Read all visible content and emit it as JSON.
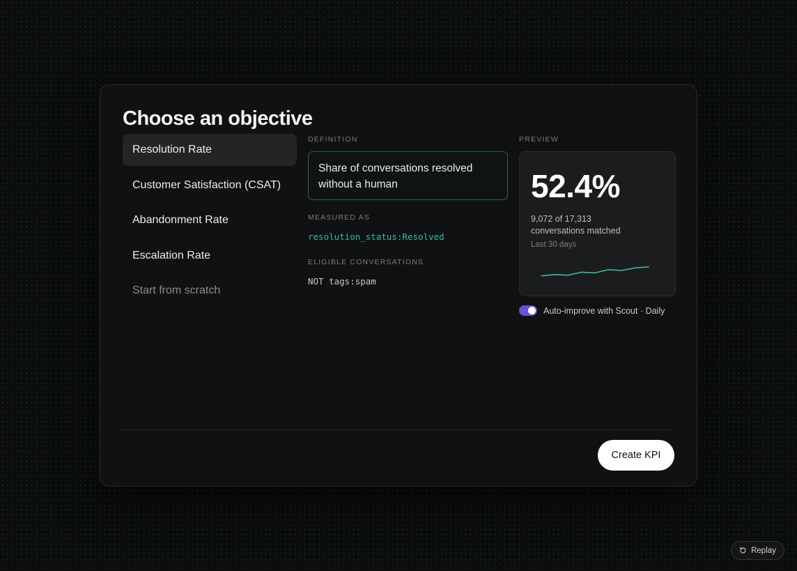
{
  "title": "Choose an objective",
  "options": [
    {
      "label": "Resolution Rate"
    },
    {
      "label": "Customer Satisfaction (CSAT)"
    },
    {
      "label": "Abandonment Rate"
    },
    {
      "label": "Escalation Rate"
    },
    {
      "label": "Start from scratch"
    }
  ],
  "definition": {
    "label": "DEFINITION",
    "text": "Share of conversations resolved without a human"
  },
  "measured": {
    "label": "MEASURED AS",
    "value": "resolution_status:Resolved"
  },
  "eligible": {
    "label": "ELIGIBLE CONVERSATIONS",
    "value": "NOT tags:spam"
  },
  "preview": {
    "label": "PREVIEW",
    "value": "52.4%",
    "matched_line1": "9,072 of 17,313",
    "matched_line2": "conversations matched",
    "period": "Last 30 days"
  },
  "auto_improve": {
    "label": "Auto-improve with Scout · Daily",
    "enabled": true
  },
  "actions": {
    "create": "Create KPI",
    "replay": "Replay"
  },
  "colors": {
    "accent_teal": "#3fb89a",
    "toggle_purple": "#6b4fd6"
  },
  "sparkline": {
    "values": [
      0.18,
      0.26,
      0.22,
      0.4,
      0.36,
      0.55,
      0.5,
      0.66,
      0.72
    ]
  }
}
